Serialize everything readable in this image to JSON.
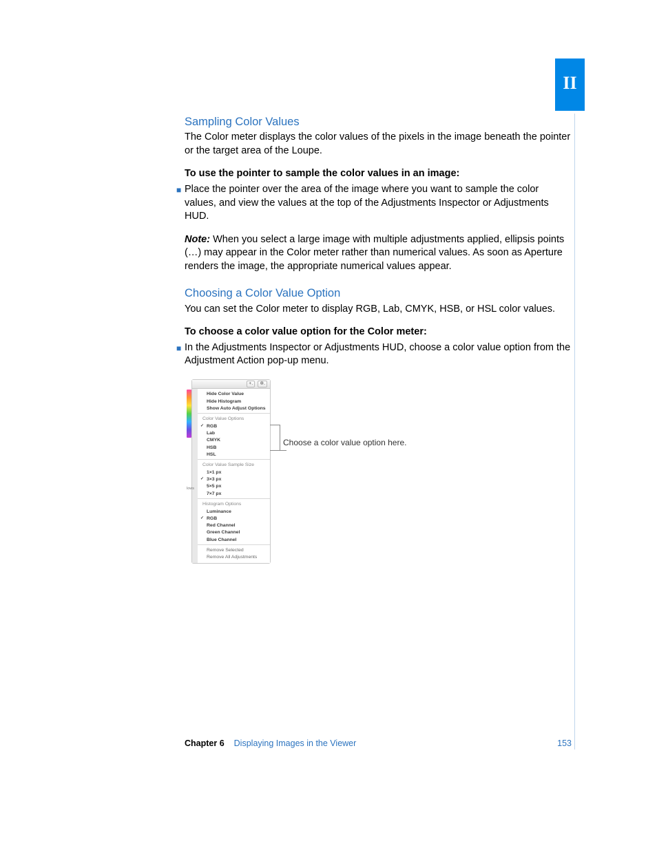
{
  "part_label": "II",
  "section1": {
    "heading": "Sampling Color Values",
    "intro": "The Color meter displays the color values of the pixels in the image beneath the pointer or the target area of the Loupe.",
    "task_lead": "To use the pointer to sample the color values in an image:",
    "bullet": "Place the pointer over the area of the image where you want to sample the color values, and view the values at the top of the Adjustments Inspector or Adjustments HUD.",
    "note_label": "Note:",
    "note_body": "  When you select a large image with multiple adjustments applied, ellipsis points (…) may appear in the Color meter rather than numerical values. As soon as Aperture renders the image, the appropriate numerical values appear."
  },
  "section2": {
    "heading": "Choosing a Color Value Option",
    "intro": "You can set the Color meter to display RGB, Lab, CMYK, HSB, or HSL color values.",
    "task_lead": "To choose a color value option for the Color meter:",
    "bullet": "In the Adjustments Inspector or Adjustments HUD, choose a color value option from the Adjustment Action pop-up menu."
  },
  "menu": {
    "header_buttons": [
      "+.",
      "✲."
    ],
    "top_items": [
      "Hide Color Value",
      "Hide Histogram",
      "Show Auto Adjust Options"
    ],
    "cvo_heading": "Color Value Options",
    "cvo_items": [
      "RGB",
      "Lab",
      "CMYK",
      "HSB",
      "HSL"
    ],
    "cvss_heading": "Color Value Sample Size",
    "cvss_items": [
      "1×1 px",
      "3×3 px",
      "5×5 px",
      "7×7 px"
    ],
    "hist_heading": "Histogram Options",
    "hist_items": [
      "Luminance",
      "RGB",
      "Red Channel",
      "Green Channel",
      "Blue Channel"
    ],
    "bottom_items": [
      "Remove Selected",
      "Remove All Adjustments"
    ],
    "left_label": "lows"
  },
  "callout": "Choose a color value option here.",
  "footer": {
    "chapter_label": "Chapter 6",
    "chapter_title": "Displaying Images in the Viewer",
    "page": "153"
  }
}
